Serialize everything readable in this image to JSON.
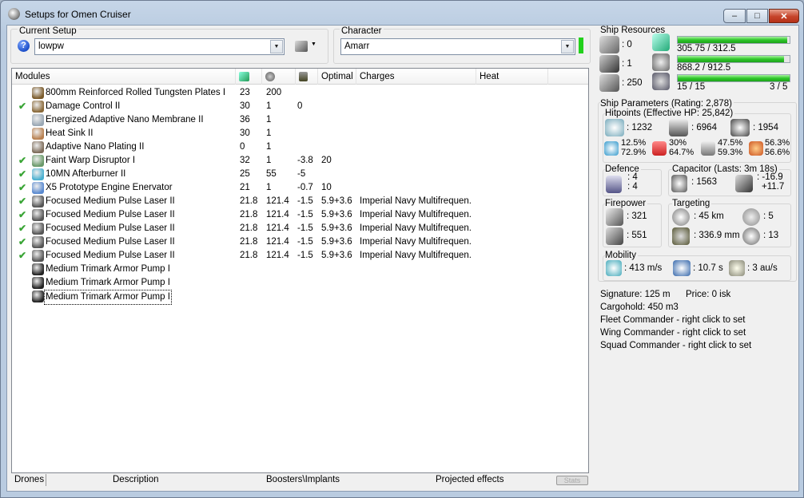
{
  "window": {
    "title": "Setups for Omen Cruiser",
    "min": "‒",
    "max": "□",
    "close": "✕"
  },
  "setup": {
    "label": "Current Setup",
    "value": "lowpw"
  },
  "character": {
    "label": "Character",
    "value": "Amarr"
  },
  "modules_header": {
    "modules": "Modules",
    "optimal": "Optimal",
    "charges": "Charges",
    "heat": "Heat"
  },
  "modules": [
    {
      "check": "",
      "name": "800mm Reinforced Rolled Tungsten Plates I",
      "cpu": "23",
      "pg": "200",
      "cap": "",
      "optimal": "",
      "charges": "",
      "icon_color": "#7a5a2a"
    },
    {
      "check": "✔",
      "name": "Damage Control II",
      "cpu": "30",
      "pg": "1",
      "cap": "0",
      "optimal": "",
      "charges": "",
      "icon_color": "#8a6a3a"
    },
    {
      "check": "",
      "name": "Energized Adaptive Nano Membrane II",
      "cpu": "36",
      "pg": "1",
      "cap": "",
      "optimal": "",
      "charges": "",
      "icon_color": "#9aa8b5"
    },
    {
      "check": "",
      "name": "Heat Sink II",
      "cpu": "30",
      "pg": "1",
      "cap": "",
      "optimal": "",
      "charges": "",
      "icon_color": "#b88050"
    },
    {
      "check": "",
      "name": "Adaptive Nano Plating II",
      "cpu": "0",
      "pg": "1",
      "cap": "",
      "optimal": "",
      "charges": "",
      "icon_color": "#7d6c5a"
    },
    {
      "check": "✔",
      "name": "Faint Warp Disruptor I",
      "cpu": "32",
      "pg": "1",
      "cap": "-3.8",
      "optimal": "20",
      "charges": "",
      "icon_color": "#6a9a6a"
    },
    {
      "check": "✔",
      "name": "10MN Afterburner II",
      "cpu": "25",
      "pg": "55",
      "cap": "-5",
      "optimal": "",
      "charges": "",
      "icon_color": "#4ab0d0"
    },
    {
      "check": "✔",
      "name": "X5 Prototype Engine Enervator",
      "cpu": "21",
      "pg": "1",
      "cap": "-0.7",
      "optimal": "10",
      "charges": "",
      "icon_color": "#5a8ad0"
    },
    {
      "check": "✔",
      "name": "Focused Medium Pulse Laser II",
      "cpu": "21.8",
      "pg": "121.4",
      "cap": "-1.5",
      "optimal": "5.9+3.6",
      "charges": "Imperial Navy Multifrequen...",
      "icon_color": "#555"
    },
    {
      "check": "✔",
      "name": "Focused Medium Pulse Laser II",
      "cpu": "21.8",
      "pg": "121.4",
      "cap": "-1.5",
      "optimal": "5.9+3.6",
      "charges": "Imperial Navy Multifrequen...",
      "icon_color": "#555"
    },
    {
      "check": "✔",
      "name": "Focused Medium Pulse Laser II",
      "cpu": "21.8",
      "pg": "121.4",
      "cap": "-1.5",
      "optimal": "5.9+3.6",
      "charges": "Imperial Navy Multifrequen...",
      "icon_color": "#555"
    },
    {
      "check": "✔",
      "name": "Focused Medium Pulse Laser II",
      "cpu": "21.8",
      "pg": "121.4",
      "cap": "-1.5",
      "optimal": "5.9+3.6",
      "charges": "Imperial Navy Multifrequen...",
      "icon_color": "#555"
    },
    {
      "check": "✔",
      "name": "Focused Medium Pulse Laser II",
      "cpu": "21.8",
      "pg": "121.4",
      "cap": "-1.5",
      "optimal": "5.9+3.6",
      "charges": "Imperial Navy Multifrequen...",
      "icon_color": "#555"
    },
    {
      "check": "",
      "name": "Medium Trimark Armor Pump I",
      "cpu": "",
      "pg": "",
      "cap": "",
      "optimal": "",
      "charges": "",
      "icon_color": "#222"
    },
    {
      "check": "",
      "name": "Medium Trimark Armor Pump I",
      "cpu": "",
      "pg": "",
      "cap": "",
      "optimal": "",
      "charges": "",
      "icon_color": "#222"
    },
    {
      "check": "",
      "name": "Medium Trimark Armor Pump I",
      "cpu": "",
      "pg": "",
      "cap": "",
      "optimal": "",
      "charges": "",
      "icon_color": "#222"
    }
  ],
  "bottom_tabs": {
    "drones": "Drones",
    "description": "Description",
    "boosters": "Boosters\\Implants",
    "projected": "Projected effects",
    "stats": "Stats"
  },
  "resources": {
    "title": "Ship Resources",
    "turrets": ": 0",
    "launchers": ": 1",
    "drone_bay": ": 250",
    "cpu": "305.75 / 312.5",
    "cpu_fill": 0.978,
    "pg": "868.2 / 912.5",
    "pg_fill": 0.951,
    "calibration": "15 / 15",
    "rigs": "3 / 5",
    "cal_fill": 1.0
  },
  "params": {
    "title": "Ship Parameters (Rating: 2,878)"
  },
  "hitpoints": {
    "title": "Hitpoints (Effective HP: 25,842)",
    "shield": ": 1232",
    "armor": ": 6964",
    "structure": ": 1954",
    "em_a": "12.5%",
    "em_b": "72.9%",
    "th_a": "30%",
    "th_b": "64.7%",
    "kin_a": "47.5%",
    "kin_b": "59.3%",
    "exp_a": "56.3%",
    "exp_b": "56.6%"
  },
  "defence": {
    "title": "Defence",
    "a": ": 4",
    "b": ": 4"
  },
  "capacitor": {
    "title": "Capacitor (Lasts: 3m 18s)",
    "cap": ": 1563",
    "a": ": -16.9",
    "b": "+11.7"
  },
  "firepower": {
    "title": "Firepower",
    "a": ": 321",
    "b": ": 551"
  },
  "targeting": {
    "title": "Targeting",
    "range": ": 45 km",
    "targets": ": 5",
    "scan": ": 336.9 mm",
    "sensor": ": 13"
  },
  "mobility": {
    "title": "Mobility",
    "speed": ": 413 m/s",
    "align": ": 10.7 s",
    "warp": ": 3 au/s"
  },
  "misc": {
    "signature": "Signature: 125 m",
    "price": "Price: 0 isk",
    "cargo": "Cargohold: 450 m3",
    "fleet": "Fleet Commander - right click to set",
    "wing": "Wing Commander - right click to set",
    "squad": "Squad Commander - right click to set"
  }
}
